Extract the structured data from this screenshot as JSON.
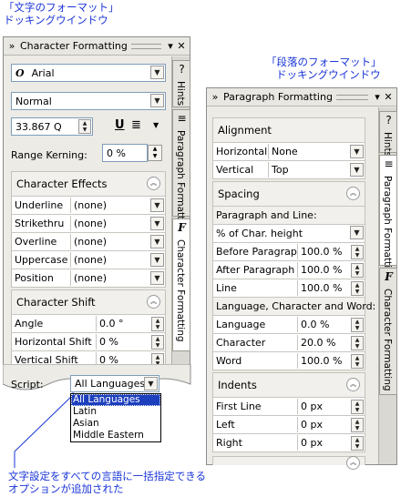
{
  "captions": {
    "left_line1": "「文字のフォーマット」",
    "left_line2": "ドッキングウインドウ",
    "right_line1": "「段落のフォーマット」",
    "right_line2": "ドッキングウインドウ",
    "note_line1": "文字設定をすべての言語に一括指定できる",
    "note_line2": "オプションが追加された"
  },
  "character_docker": {
    "title": "Character Formatting",
    "font_name": "Arial",
    "font_style": "Normal",
    "font_size": "33.867 Q",
    "range_kerning_label": "Range Kerning:",
    "range_kerning_value": "0 %",
    "effects": {
      "title": "Character Effects",
      "rows": [
        {
          "label": "Underline",
          "value": "(none)"
        },
        {
          "label": "Strikethru",
          "value": "(none)"
        },
        {
          "label": "Overline",
          "value": "(none)"
        },
        {
          "label": "Uppercase",
          "value": "(none)"
        },
        {
          "label": "Position",
          "value": "(none)"
        }
      ]
    },
    "shift": {
      "title": "Character Shift",
      "rows": [
        {
          "label": "Angle",
          "value": "0.0 °"
        },
        {
          "label": "Horizontal Shift",
          "value": "0 %"
        },
        {
          "label": "Vertical Shift",
          "value": "0 %"
        }
      ]
    },
    "script_label": "Script:",
    "script_value": "All Languages",
    "script_options": [
      "All Languages",
      "Latin",
      "Asian",
      "Middle Eastern"
    ],
    "tabs": [
      "Hints",
      "Paragraph Formatting",
      "Character Formatting"
    ]
  },
  "paragraph_docker": {
    "title": "Paragraph Formatting",
    "alignment": {
      "title": "Alignment",
      "rows": [
        {
          "label": "Horizontal",
          "value": "None"
        },
        {
          "label": "Vertical",
          "value": "Top"
        }
      ]
    },
    "spacing": {
      "title": "Spacing",
      "para_line_label": "Paragraph and Line:",
      "para_line_unit": "% of Char. height",
      "rows": [
        {
          "label": "Before Paragraph",
          "value": "100.0 %"
        },
        {
          "label": "After Paragraph",
          "value": "100.0 %"
        },
        {
          "label": "Line",
          "value": "100.0 %"
        }
      ],
      "lang_label": "Language, Character and Word:",
      "rows2": [
        {
          "label": "Language",
          "value": "0.0 %"
        },
        {
          "label": "Character",
          "value": "20.0 %"
        },
        {
          "label": "Word",
          "value": "100.0 %"
        }
      ]
    },
    "indents": {
      "title": "Indents",
      "rows": [
        {
          "label": "First Line",
          "value": "0 px"
        },
        {
          "label": "Left",
          "value": "0 px"
        },
        {
          "label": "Right",
          "value": "0 px"
        }
      ]
    },
    "tabs": [
      "Hints",
      "Paragraph Formatting",
      "Character Formatting"
    ]
  }
}
